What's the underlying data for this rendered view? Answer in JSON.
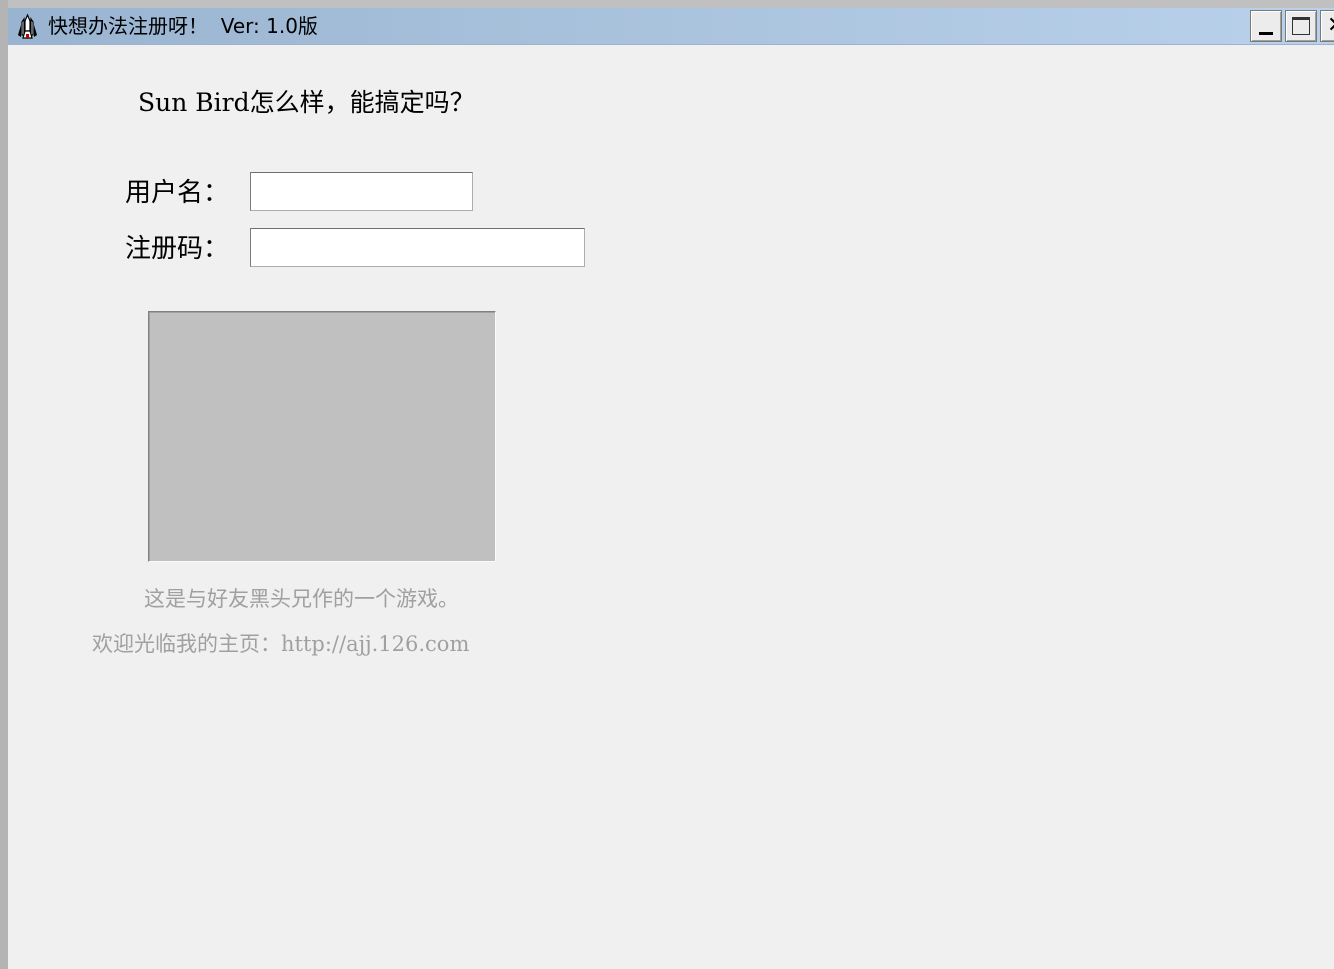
{
  "window": {
    "title": "快想办法注册呀！  Ver: 1.0版",
    "icon": "space-shuttle-icon",
    "controls": {
      "minimize": "minimize-icon",
      "maximize": "maximize-icon",
      "close_glyph": "✕"
    }
  },
  "main": {
    "heading": "Sun Bird怎么样，能搞定吗？",
    "username_label": "用户名：",
    "username_value": "",
    "regcode_label": "注册码：",
    "regcode_value": "",
    "info_line_1": "这是与好友黑头兄作的一个游戏。",
    "info_line_2": "欢迎光临我的主页：http://ajj.126.com"
  },
  "colors": {
    "titlebar_start": "#99b4d1",
    "titlebar_end": "#b9d1ea",
    "window_bg": "#f0f0f0",
    "panel_bg": "#c0c0c0",
    "info_text": "#a0a0a0"
  }
}
